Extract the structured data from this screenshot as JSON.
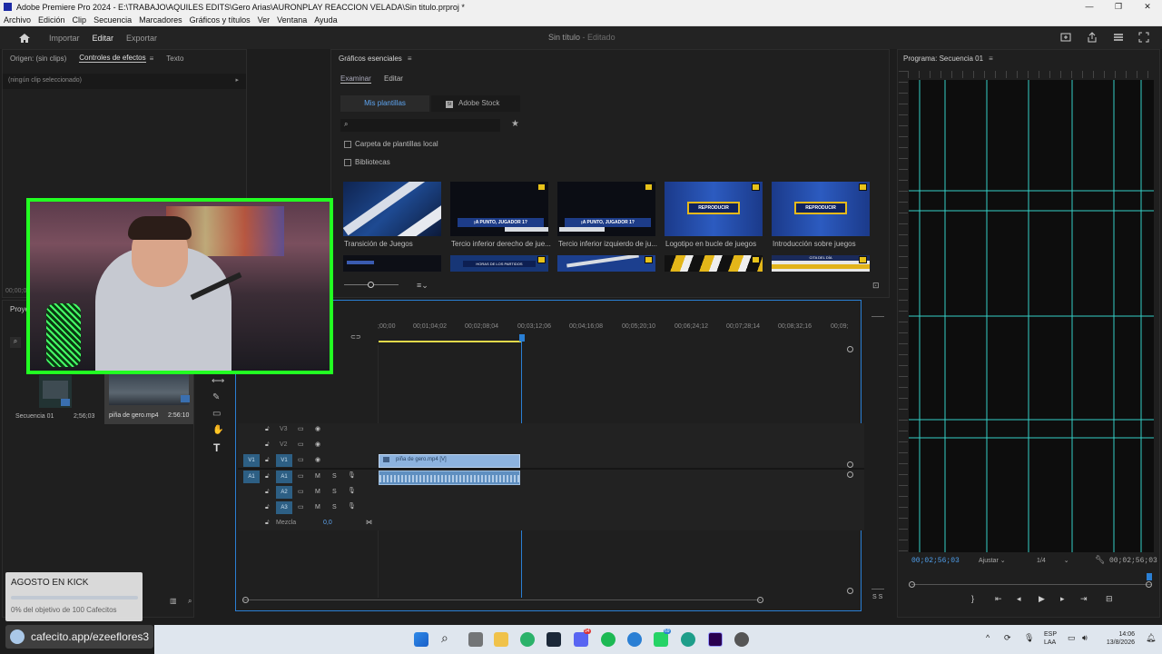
{
  "window": {
    "title": "Adobe Premiere Pro 2024 - E:\\TRABAJO\\AQUILES EDITS\\Gero Arias\\AURONPLAY REACCION VELADA\\Sin titulo.prproj *",
    "controls": [
      "—",
      "❐",
      "✕"
    ]
  },
  "menu": [
    "Archivo",
    "Edición",
    "Clip",
    "Secuencia",
    "Marcadores",
    "Gráficos y títulos",
    "Ver",
    "Ventana",
    "Ayuda"
  ],
  "workspace": {
    "tabs": [
      "Importar",
      "Editar",
      "Exportar"
    ],
    "active": "Editar",
    "project_title": "Sin título",
    "project_state": "- Editado"
  },
  "effects_panel": {
    "tabs": [
      "Origen: (sin clips)",
      "Controles de efectos",
      "Texto"
    ],
    "no_clip": "(ningún clip seleccionado)",
    "timecode": "00;00;00"
  },
  "essential_graphics": {
    "title": "Gráficos esenciales",
    "subtabs": [
      "Examinar",
      "Editar"
    ],
    "buttons": [
      "Mis plantillas",
      "Adobe Stock"
    ],
    "stock_icon_label": "St",
    "checkboxes": [
      "Carpeta de plantillas local",
      "Bibliotecas"
    ],
    "templates": [
      {
        "label": "Transición de Juegos",
        "text": ""
      },
      {
        "label": "Tercio inferior derecho de jue...",
        "text": "¡A PUNTO, JUGADOR 1?"
      },
      {
        "label": "Tercio inferior izquierdo de ju...",
        "text": "¡A PUNTO, JUGADOR 1?"
      },
      {
        "label": "Logotipo en bucle de juegos",
        "text": "REPRODUCIR"
      },
      {
        "label": "Introducción sobre juegos",
        "text": "REPRODUCIR"
      }
    ],
    "row2_texts": [
      "",
      "HORAS DE LOS PARTIDOS",
      "",
      "",
      "CITA DEL DÍA"
    ]
  },
  "project_panel": {
    "tab": "Proye",
    "items": [
      {
        "name": "Secuencia 01",
        "duration": "2;56;03"
      },
      {
        "name": "piña de gero.mp4",
        "duration": "2:56:10"
      }
    ]
  },
  "timeline": {
    "ruler": [
      ";00;00",
      "00;01;04;02",
      "00;02;08;04",
      "00;03;12;06",
      "00;04;16;08",
      "00;05;20;10",
      "00;06;24;12",
      "00;07;28;14",
      "00;08;32;16",
      "00;09;"
    ],
    "video_tracks": [
      {
        "name": "V3",
        "src": ""
      },
      {
        "name": "V2",
        "src": ""
      },
      {
        "name": "V1",
        "src": "V1"
      }
    ],
    "audio_tracks": [
      {
        "name": "A1",
        "src": "A1"
      },
      {
        "name": "A2",
        "src": ""
      },
      {
        "name": "A3",
        "src": ""
      }
    ],
    "audio_buttons": [
      "M",
      "S"
    ],
    "mix_label": "Mezcla",
    "mix_value": "0,0",
    "video_clip": "piña de gero.mp4 [V]"
  },
  "program_monitor": {
    "title": "Programa: Secuencia 01",
    "timecode_left": "00;02;56;03",
    "fit": "Ajustar",
    "quality": "1/4",
    "timecode_right": "00;02;56;03"
  },
  "overlay": {
    "campaign": "AGOSTO EN KICK",
    "progress_text": "0% del objetivo de 100 Cafecitos",
    "progress": 0,
    "link": "cafecito.app/ezeeflores3"
  },
  "taskbar": {
    "language": "ESP",
    "region": "LAA",
    "time": "14:06",
    "date": "13/8/2026",
    "badges": [
      "94",
      "69"
    ]
  },
  "colors": {
    "accent_blue": "#2a7fd4",
    "webcam_border": "#22ff22",
    "guide_cyan": "#35d0c7",
    "clip_video": "#8db3df",
    "clip_audio": "#5f8fc0"
  }
}
